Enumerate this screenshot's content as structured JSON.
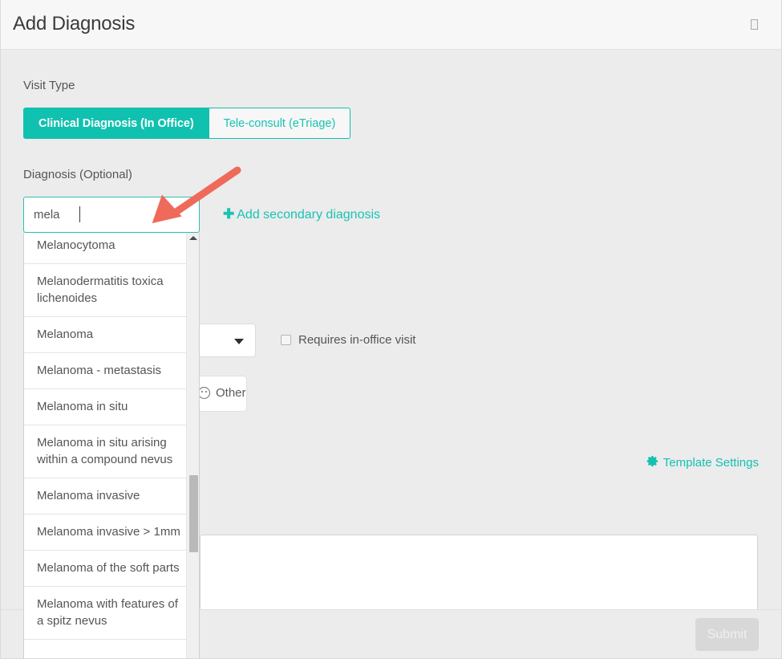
{
  "header": {
    "title": "Add Diagnosis",
    "close_icon": "close-icon",
    "close_glyph": ""
  },
  "form": {
    "visit_type_label": "Visit Type",
    "visit_type_options": [
      {
        "label": "Clinical Diagnosis (In Office)",
        "active": true
      },
      {
        "label": "Tele-consult (eTriage)",
        "active": false
      }
    ],
    "diagnosis_label": "Diagnosis (Optional)",
    "diagnosis_input": {
      "value": "mela",
      "placeholder": ""
    },
    "add_secondary_label": "Add secondary diagnosis",
    "add_secondary_icon": "plus-icon",
    "laterality_select": {
      "value": "",
      "caret_icon": "chevron-down-icon"
    },
    "requires_in_office": {
      "label": "Requires in-office visit",
      "checked": false
    },
    "other_chip": {
      "label": "Other",
      "icon": "smiley-face-icon"
    },
    "template_settings_label": "Template Settings",
    "template_settings_icon": "gear-icon",
    "notes": {
      "value": "",
      "placeholder": ""
    }
  },
  "autocomplete": {
    "items": [
      "Melanocytoma",
      "Melanodermatitis toxica lichenoides",
      "Melanoma",
      "Melanoma - metastasis",
      "Melanoma in situ",
      "Melanoma in situ arising within a compound nevus",
      "Melanoma invasive",
      "Melanoma invasive > 1mm",
      "Melanoma of the soft parts",
      "Melanoma with features of a spitz nevus"
    ],
    "scroll_up_icon": "scroll-up-arrow-icon"
  },
  "footer": {
    "submit_label": "Submit",
    "submit_disabled": true
  },
  "annotation": {
    "arrow_icon": "annotation-arrow-icon",
    "color": "#ef6a5a"
  },
  "colors": {
    "accent": "#11c1b0",
    "header_bg": "#f7f7f7",
    "body_bg": "#ececec",
    "text": "#555555",
    "annotation": "#ef6a5a"
  }
}
